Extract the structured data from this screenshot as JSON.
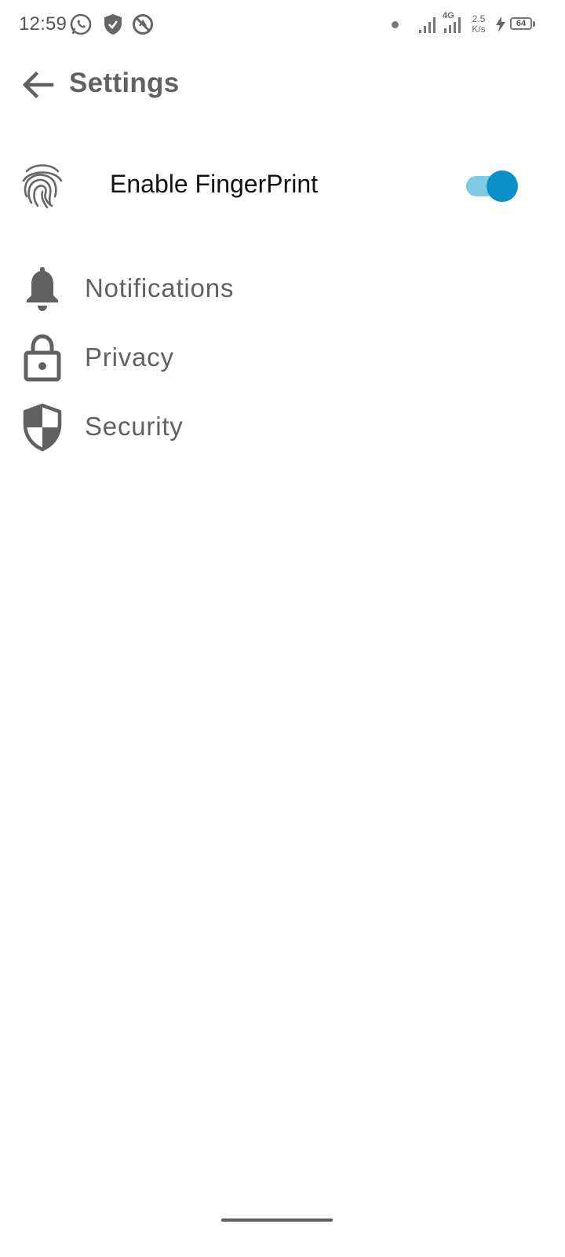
{
  "status_bar": {
    "time": "12:59",
    "network_label": "4G",
    "net_speed_value": "2.5",
    "net_speed_unit": "K/s",
    "battery": "64",
    "icons": [
      "whatsapp-icon",
      "shield-check-icon",
      "no-sync-icon",
      "notification-dot-icon",
      "signal-icon",
      "signal-4g-icon",
      "charging-icon",
      "battery-icon"
    ]
  },
  "header": {
    "title": "Settings",
    "back_icon": "arrow-left-icon"
  },
  "fingerprint": {
    "label": "Enable FingerPrint",
    "icon": "fingerprint-icon",
    "enabled": true,
    "accent_color": "#0a8fc8",
    "track_color": "#7fcbe6"
  },
  "menu": {
    "items": [
      {
        "label": "Notifications",
        "icon": "bell-icon"
      },
      {
        "label": "Privacy",
        "icon": "lock-icon"
      },
      {
        "label": "Security",
        "icon": "shield-icon"
      }
    ]
  }
}
